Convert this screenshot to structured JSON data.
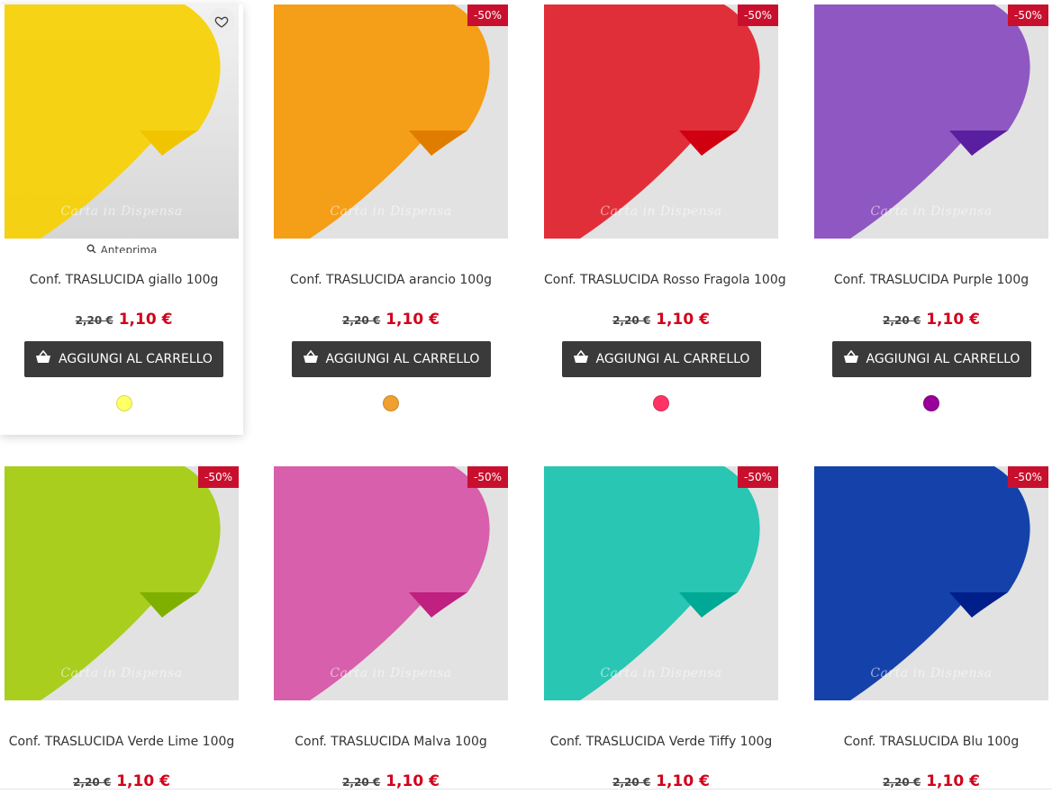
{
  "products": [
    {
      "name": "Conf. TRASLUCIDA giallo 100g",
      "old_price": "2,20 €",
      "new_price": "1,10 €",
      "discount": "",
      "color": "#f7d108",
      "swatch": "#ffff66",
      "watermark": "Carta in Dispensa",
      "preview": "Anteprima",
      "cart_label": "AGGIUNGI AL CARRELLO",
      "hovered": true
    },
    {
      "name": "Conf. TRASLUCIDA arancio 100g",
      "old_price": "2,20 €",
      "new_price": "1,10 €",
      "discount": "-50%",
      "color": "#f59a0c",
      "swatch": "#f0a030",
      "watermark": "Carta in Dispensa",
      "cart_label": "AGGIUNGI AL CARRELLO"
    },
    {
      "name": "Conf. TRASLUCIDA Rosso Fragola 100g",
      "old_price": "2,20 €",
      "new_price": "1,10 €",
      "discount": "-50%",
      "color": "#e0252f",
      "swatch": "#ff3366",
      "watermark": "Carta in Dispensa",
      "cart_label": "AGGIUNGI AL CARRELLO"
    },
    {
      "name": "Conf. TRASLUCIDA Purple 100g",
      "old_price": "2,20 €",
      "new_price": "1,10 €",
      "discount": "-50%",
      "color": "#8a4fbf",
      "swatch": "#990099",
      "watermark": "Carta in Dispensa",
      "cart_label": "AGGIUNGI AL CARRELLO"
    },
    {
      "name": "Conf. TRASLUCIDA Verde Lime 100g",
      "old_price": "2,20 €",
      "new_price": "1,10 €",
      "discount": "-50%",
      "color": "#a5cc12",
      "watermark": "Carta in Dispensa"
    },
    {
      "name": "Conf. TRASLUCIDA Malva 100g",
      "old_price": "2,20 €",
      "new_price": "1,10 €",
      "discount": "-50%",
      "color": "#d657a8",
      "watermark": "Carta in Dispensa"
    },
    {
      "name": "Conf. TRASLUCIDA Verde Tiffy 100g",
      "old_price": "2,20 €",
      "new_price": "1,10 €",
      "discount": "-50%",
      "color": "#1ec4b0",
      "watermark": "Carta in Dispensa"
    },
    {
      "name": "Conf. TRASLUCIDA Blu 100g",
      "old_price": "2,20 €",
      "new_price": "1,10 €",
      "discount": "-50%",
      "color": "#0e3da8",
      "watermark": "Carta in Dispensa"
    }
  ]
}
